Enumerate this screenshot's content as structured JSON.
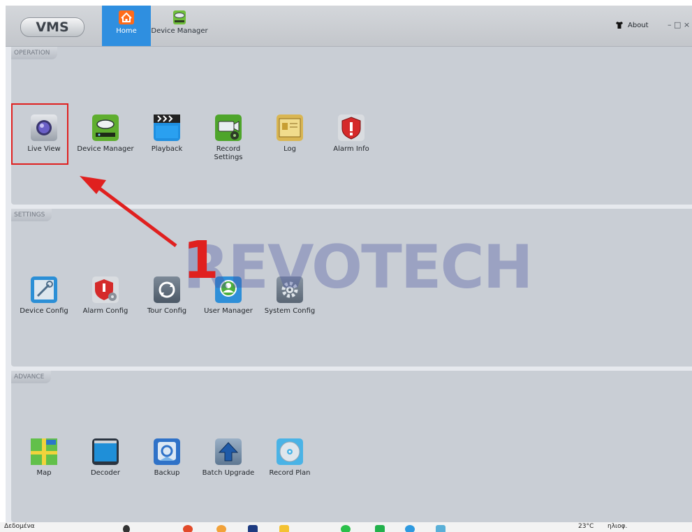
{
  "header": {
    "logo": "VMS",
    "tabs": [
      {
        "label": "Home",
        "icon": "home-icon",
        "active": true
      },
      {
        "label": "Device Manager",
        "icon": "device-manager-icon",
        "active": false
      }
    ],
    "about": "About",
    "window_controls": "– □ ×"
  },
  "sections": [
    {
      "label": "OPERATION",
      "items": [
        {
          "label": "Live View",
          "icon": "camera-icon"
        },
        {
          "label": "Device Manager",
          "icon": "dvr-icon"
        },
        {
          "label": "Playback",
          "icon": "clapperboard-icon"
        },
        {
          "label": "Record\nSettings",
          "icon": "record-settings-icon"
        },
        {
          "label": "Log",
          "icon": "log-icon"
        },
        {
          "label": "Alarm Info",
          "icon": "alarm-shield-icon"
        }
      ]
    },
    {
      "label": "SETTINGS",
      "items": [
        {
          "label": "Device Config",
          "icon": "device-config-icon"
        },
        {
          "label": "Alarm Config",
          "icon": "alarm-config-icon"
        },
        {
          "label": "Tour Config",
          "icon": "tour-icon"
        },
        {
          "label": "User Manager",
          "icon": "user-icon"
        },
        {
          "label": "System Config",
          "icon": "gear-icon"
        }
      ]
    },
    {
      "label": "ADVANCE",
      "items": [
        {
          "label": "Map",
          "icon": "map-icon"
        },
        {
          "label": "Decoder",
          "icon": "decoder-icon"
        },
        {
          "label": "Backup",
          "icon": "backup-icon"
        },
        {
          "label": "Batch Upgrade",
          "icon": "upload-icon"
        },
        {
          "label": "Record Plan",
          "icon": "disc-icon"
        }
      ]
    }
  ],
  "annotation": {
    "step": "1",
    "watermark": "REVOTECH",
    "color": "#e0201f"
  },
  "taskbar": {
    "left_text": "Δεδομένα",
    "weather": "23°C",
    "status": "ηλιοφ."
  },
  "colors": {
    "active_tab": "#2f8fe0",
    "highlight": "#e0201f",
    "panel": "#c9ced5"
  }
}
